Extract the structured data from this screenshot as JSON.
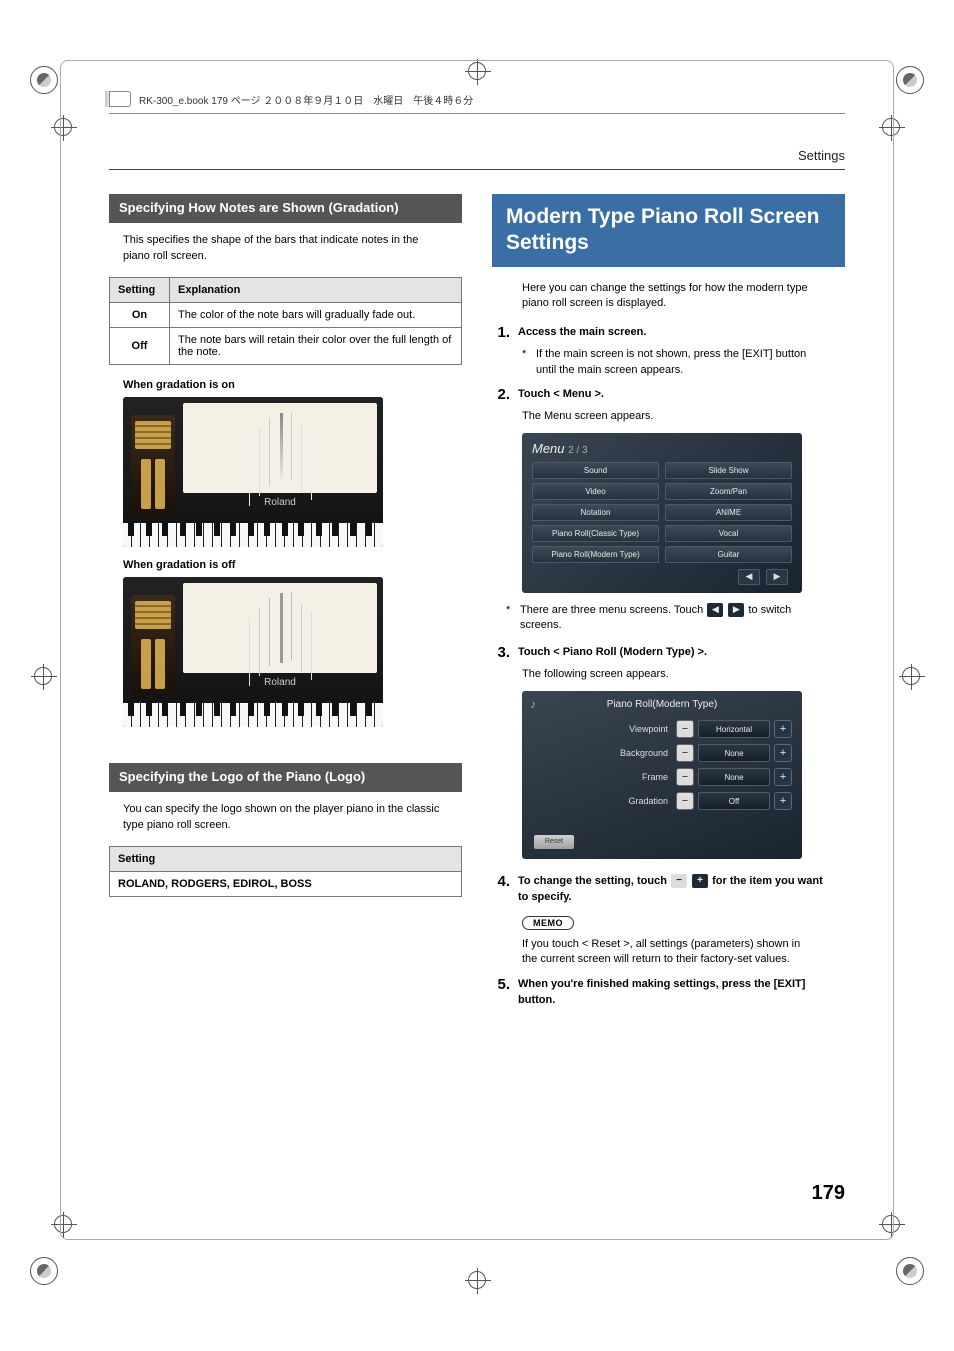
{
  "book_header": "RK-300_e.book  179 ページ  ２００８年９月１０日　水曜日　午後４時６分",
  "running_header": "Settings",
  "page_number": "179",
  "left": {
    "sec1": {
      "title": "Specifying How Notes are Shown (Gradation)",
      "intro": "This specifies the shape of the bars that indicate notes in the piano roll screen.",
      "table": {
        "h1": "Setting",
        "h2": "Explanation",
        "r1c1": "On",
        "r1c2": "The color of the note bars will gradually fade out.",
        "r2c1": "Off",
        "r2c2": "The note bars will retain their color over the full length of the note."
      },
      "cap_on": "When gradation is on",
      "cap_off": "When gradation is off",
      "logo_text": "Roland"
    },
    "sec2": {
      "title": "Specifying the Logo of the Piano (Logo)",
      "intro": "You can specify the logo shown on the player piano in the classic type piano roll screen.",
      "table": {
        "h1": "Setting",
        "r1": "ROLAND, RODGERS, EDIROL, BOSS"
      }
    }
  },
  "right": {
    "heading": "Modern Type Piano Roll Screen Settings",
    "intro": "Here you can change the settings for how the modern type piano roll screen is displayed.",
    "steps": {
      "s1": {
        "num": "1.",
        "label": "Access the main screen.",
        "note": "If the main screen is not shown, press the [EXIT] button until the main screen appears."
      },
      "s2": {
        "num": "2.",
        "label": "Touch < Menu >.",
        "sub": "The Menu screen appears."
      },
      "menu": {
        "title": "Menu",
        "page": "2 / 3",
        "items": [
          [
            "Sound",
            "Slide Show"
          ],
          [
            "Video",
            "Zoom/Pan"
          ],
          [
            "Notation",
            "ANIME"
          ],
          [
            "Piano Roll(Classic Type)",
            "Vocal"
          ],
          [
            "Piano Roll(Modern Type)",
            "Guitar"
          ]
        ],
        "left_arrow": "◀",
        "right_arrow": "▶"
      },
      "menu_note_pre": "There are three menu screens. Touch",
      "menu_note_post": "to switch screens.",
      "s3": {
        "num": "3.",
        "label": "Touch < Piano Roll (Modern Type) >.",
        "sub": "The following screen appears."
      },
      "modern": {
        "title": "Piano Roll(Modern Type)",
        "rows": [
          {
            "label": "Viewpoint",
            "value": "Horizontal"
          },
          {
            "label": "Background",
            "value": "None"
          },
          {
            "label": "Frame",
            "value": "None"
          },
          {
            "label": "Gradation",
            "value": "Off"
          }
        ],
        "reset_label": "Reset",
        "minus": "−",
        "plus": "+",
        "note": "♪"
      },
      "s4": {
        "num": "4.",
        "label_pre": "To change the setting, touch",
        "label_post": "for the item you want to specify."
      },
      "memo": "MEMO",
      "memo_text": "If you touch < Reset >, all settings (parameters) shown in the current screen will return to their factory-set values.",
      "s5": {
        "num": "5.",
        "label": "When you're finished making settings, press the [EXIT] button."
      }
    }
  },
  "glyphs": {
    "ast": "*",
    "minus": "−",
    "plus": "+",
    "left": "◀",
    "right": "▶"
  }
}
